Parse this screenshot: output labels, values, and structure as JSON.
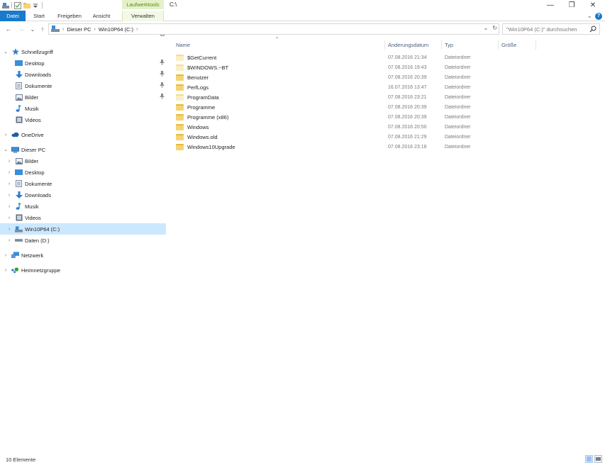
{
  "titlebar": {
    "context_tab_title": "Laufwerktools",
    "window_title": "C:\\",
    "minimize": "—",
    "restore": "❐",
    "close": "✕"
  },
  "ribbon": {
    "tabs": [
      "Datei",
      "Start",
      "Freigeben",
      "Ansicht",
      "Verwalten"
    ],
    "expand_glyph": "⌄",
    "help_glyph": "?"
  },
  "nav": {
    "back": "←",
    "forward": "→",
    "recent": "⌄",
    "up": "↑",
    "breadcrumb": [
      "Dieser PC",
      "Win10P64 (C:)"
    ],
    "crumb_separator": "›",
    "dropdown": "⌄",
    "refresh": "↻",
    "search_placeholder": "\"Win10P64 (C:)\" durchsuchen"
  },
  "navpane": {
    "quick_access": "Schnellzugriff",
    "quick_items": [
      "Desktop",
      "Downloads",
      "Dokumente",
      "Bilder",
      "Musik",
      "Videos"
    ],
    "onedrive": "OneDrive",
    "this_pc": "Dieser PC",
    "pc_items": [
      "Bilder",
      "Desktop",
      "Dokumente",
      "Downloads",
      "Musik",
      "Videos",
      "Win10P64 (C:)",
      "Daten (D:)"
    ],
    "network": "Netzwerk",
    "homegroup": "Heimnetzgruppe",
    "expand_glyph": "›",
    "collapse_glyph": "⌄",
    "pin_glyph": "📌"
  },
  "columns": {
    "name": "Name",
    "date": "Änderungsdatum",
    "type": "Typ",
    "size": "Größe",
    "sort_glyph": "^"
  },
  "files": [
    {
      "name": "$GetCurrent",
      "date": "07.08.2016 21:34",
      "type": "Dateiordner",
      "hidden": true
    },
    {
      "name": "$WINDOWS.~BT",
      "date": "07.08.2016 19:43",
      "type": "Dateiordner",
      "hidden": true
    },
    {
      "name": "Benutzer",
      "date": "07.08.2016 20:39",
      "type": "Dateiordner",
      "hidden": false
    },
    {
      "name": "PerfLogs",
      "date": "16.07.2016 13:47",
      "type": "Dateiordner",
      "hidden": false
    },
    {
      "name": "ProgramData",
      "date": "07.08.2016 23:21",
      "type": "Dateiordner",
      "hidden": true
    },
    {
      "name": "Programme",
      "date": "07.08.2016 20:39",
      "type": "Dateiordner",
      "hidden": false
    },
    {
      "name": "Programme (x86)",
      "date": "07.08.2016 20:39",
      "type": "Dateiordner",
      "hidden": false
    },
    {
      "name": "Windows",
      "date": "07.08.2016 20:50",
      "type": "Dateiordner",
      "hidden": false
    },
    {
      "name": "Windows.old",
      "date": "07.08.2016 21:29",
      "type": "Dateiordner",
      "hidden": false
    },
    {
      "name": "Windows10Upgrade",
      "date": "07.08.2016 23:18",
      "type": "Dateiordner",
      "hidden": false
    }
  ],
  "status": {
    "count": "10 Elemente"
  },
  "colors": {
    "accent": "#1979ca",
    "selection": "#cce8ff",
    "context_tab": "#e4f1c8",
    "folder": "#f5d474"
  }
}
